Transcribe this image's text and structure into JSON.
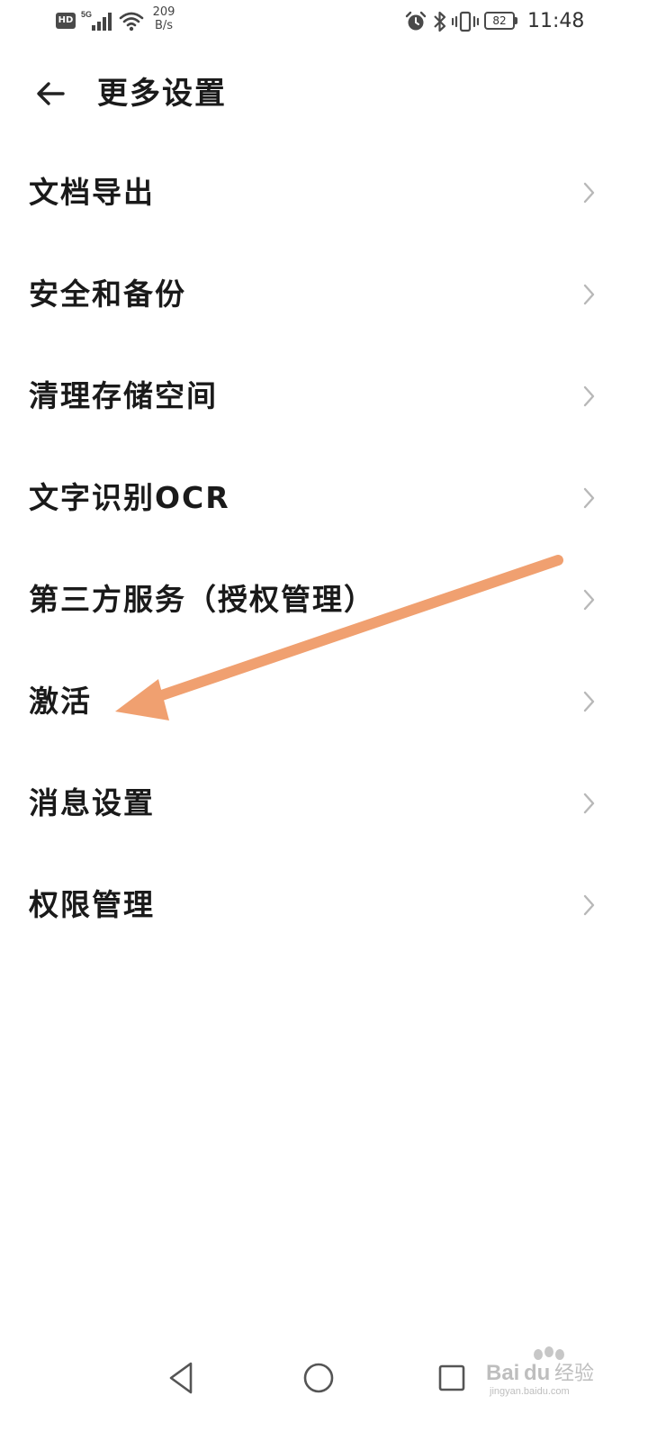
{
  "status_bar": {
    "hd_label": "HD",
    "network_type": "5G",
    "net_speed_value": "209",
    "net_speed_unit": "B/s",
    "battery_level": "82",
    "time": "11:48"
  },
  "header": {
    "title": "更多设置",
    "back_icon": "back-arrow-icon"
  },
  "settings": {
    "items": [
      {
        "label": "文档导出"
      },
      {
        "label": "安全和备份"
      },
      {
        "label": "清理存储空间"
      },
      {
        "label": "文字识别OCR"
      },
      {
        "label": "第三方服务（授权管理）"
      },
      {
        "label": "激活"
      },
      {
        "label": "消息设置"
      },
      {
        "label": "权限管理"
      }
    ]
  },
  "annotation": {
    "arrow_color": "#f0a070"
  },
  "watermark": {
    "brand": "Baidu经验",
    "url": "jingyan.baidu.com"
  },
  "colors": {
    "background": "#ffffff",
    "text": "#1a1a1a",
    "chevron": "#b8b8b8"
  }
}
